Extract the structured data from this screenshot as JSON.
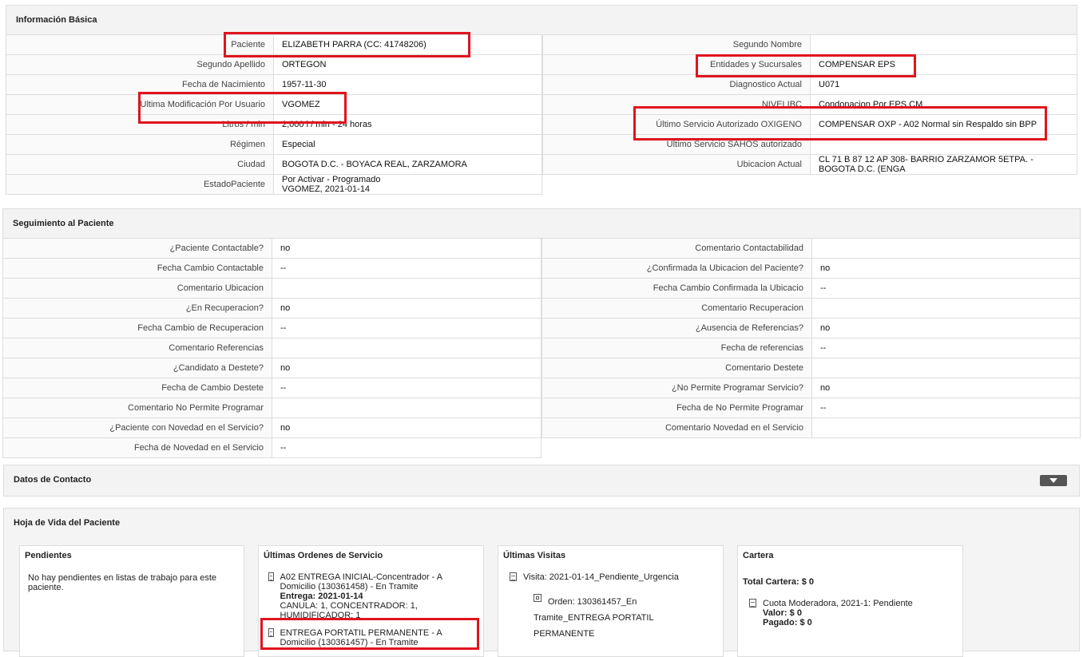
{
  "basic": {
    "title": "Información Básica",
    "left": [
      {
        "label": "Paciente",
        "value": "ELIZABETH PARRA (CC: 41748206)"
      },
      {
        "label": "Segundo Apellido",
        "value": "ORTEGON"
      },
      {
        "label": "Fecha de Nacimiento",
        "value": "1957-11-30"
      },
      {
        "label": "Ultima Modificación Por Usuario",
        "value": "VGOMEZ"
      },
      {
        "label": "Litros / min",
        "value": "2,000 l / min - 24 horas"
      },
      {
        "label": "Régimen",
        "value": "Especial"
      },
      {
        "label": "Ciudad",
        "value": "BOGOTA D.C. - BOYACA REAL, ZARZAMORA"
      },
      {
        "label": "EstadoPaciente",
        "value": "Por Activar - Programado",
        "value2": "VGOMEZ, 2021-01-14"
      }
    ],
    "right": [
      {
        "label": "Segundo Nombre",
        "value": ""
      },
      {
        "label": "Entidades y Sucursales",
        "value": "COMPENSAR EPS"
      },
      {
        "label": "Diagnostico Actual",
        "value": "U071"
      },
      {
        "label": "NIVELIBC",
        "value": "Condonacion Por EPS CM"
      },
      {
        "label": "Último Servicio Autorizado OXIGENO",
        "value": "COMPENSAR OXP - A02 Normal sin Respaldo sin BPP"
      },
      {
        "label": "Ultimo Servicio SAHOS autorizado",
        "value": ""
      },
      {
        "label": "Ubicacion Actual",
        "value": "CL 71 B 87 12 AP 308- BARRIO ZARZAMOR 5ETPA. - BOGOTA D.C. (ENGA"
      }
    ]
  },
  "tracking": {
    "title": "Seguimiento al Paciente",
    "left": [
      {
        "label": "¿Paciente Contactable?",
        "value": "no"
      },
      {
        "label": "Fecha Cambio Contactable",
        "value": "--"
      },
      {
        "label": "Comentario Ubicacion",
        "value": ""
      },
      {
        "label": "¿En Recuperacion?",
        "value": "no"
      },
      {
        "label": "Fecha Cambio de Recuperacion",
        "value": "--"
      },
      {
        "label": "Comentario Referencias",
        "value": ""
      },
      {
        "label": "¿Candidato a Destete?",
        "value": "no"
      },
      {
        "label": "Fecha de Cambio Destete",
        "value": "--"
      },
      {
        "label": "Comentario No Permite Programar",
        "value": ""
      },
      {
        "label": "¿Paciente con Novedad en el Servicio?",
        "value": "no"
      },
      {
        "label": "Fecha de Novedad en el Servicio",
        "value": "--"
      }
    ],
    "right": [
      {
        "label": "Comentario Contactabilidad",
        "value": ""
      },
      {
        "label": "¿Confirmada la Ubicacion del Paciente?",
        "value": "no"
      },
      {
        "label": "Fecha Cambio Confirmada la Ubicacio",
        "value": "--"
      },
      {
        "label": "Comentario Recuperacion",
        "value": ""
      },
      {
        "label": "¿Ausencia de Referencias?",
        "value": "no"
      },
      {
        "label": "Fecha de referencias",
        "value": "--"
      },
      {
        "label": "Comentario Destete",
        "value": ""
      },
      {
        "label": "¿No Permite Programar Servicio?",
        "value": "no"
      },
      {
        "label": "Fecha de No Permite Programar",
        "value": "--"
      },
      {
        "label": "Comentario Novedad en el Servicio",
        "value": ""
      }
    ]
  },
  "contact": {
    "title": "Datos de Contacto"
  },
  "history": {
    "title": "Hoja de Vida del Paciente",
    "pending": {
      "title": "Pendientes",
      "text": "No hay pendientes en listas de trabajo para este paciente."
    },
    "orders": {
      "title": "Últimas Ordenes de Servicio",
      "o1_title": "A02 ENTREGA INICIAL-Concentrador - A Domicilio (130361458) - En Tramite",
      "o1_delivery_label": "Entrega:",
      "o1_delivery": "2021-01-14",
      "o1_items": "CANULA: 1, CONCENTRADOR: 1, HUMIDIFICADOR: 1",
      "o2_title": "ENTREGA PORTATIL PERMANENTE - A Domicilio (130361457) - En Tramite"
    },
    "visits": {
      "title": "Últimas Visitas",
      "visit": "Visita: 2021-01-14_Pendiente_Urgencia",
      "order_line1": "Orden: 130361457_En",
      "order_line2": "Tramite_ENTREGA PORTATIL",
      "order_line3": "PERMANENTE"
    },
    "portfolio": {
      "title": "Cartera",
      "total": "Total Cartera: $ 0",
      "item": "Cuota Moderadora, 2021-1: Pendiente",
      "valor_label": "Valor:",
      "valor": "$ 0",
      "pagado_label": "Pagado:",
      "pagado": "$ 0"
    }
  },
  "colors": {
    "highlight": "#e0141e",
    "panel_bg": "#f3f3f3",
    "border": "#dddddd"
  }
}
